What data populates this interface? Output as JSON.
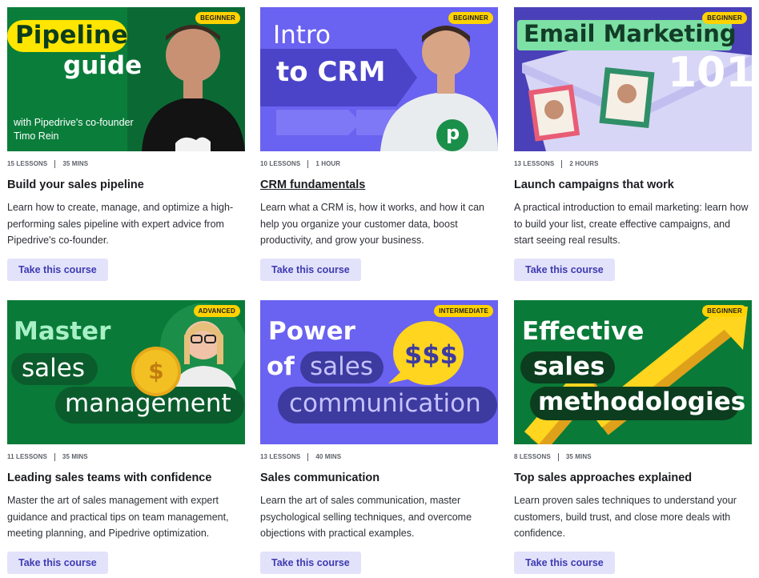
{
  "cards": [
    {
      "badge": "BEGINNER",
      "lessons": "15 LESSONS",
      "duration": "35 MINS",
      "title": "Build your sales pipeline",
      "description": "Learn how to create, manage, and optimize a high-performing sales pipeline with expert advice from Pipedrive's co-founder.",
      "button": "Take this course",
      "art": {
        "line1": "Pipeline",
        "line2": "guide",
        "caption1": "with Pipedrive's co-founder",
        "caption2": "Timo Rein"
      }
    },
    {
      "badge": "BEGINNER",
      "lessons": "10 LESSONS",
      "duration": "1 HOUR",
      "title": "CRM fundamentals",
      "description": "Learn what a CRM is, how it works, and how it can help you organize your customer data, boost productivity, and grow your business.",
      "button": "Take this course",
      "art": {
        "line1": "Intro",
        "line2": "to CRM",
        "logo": "p"
      }
    },
    {
      "badge": "BEGINNER",
      "lessons": "13 LESSONS",
      "duration": "2 HOURS",
      "title": "Launch campaigns that work",
      "description": "A practical introduction to email marketing: learn how to build your list, create effective campaigns, and start seeing real results.",
      "button": "Take this course",
      "art": {
        "line1": "Email Marketing",
        "line2": "101"
      }
    },
    {
      "badge": "ADVANCED",
      "lessons": "11 LESSONS",
      "duration": "35 MINS",
      "title": "Leading sales teams with confidence",
      "description": "Master the art of sales management with expert guidance and practical tips on team management, meeting planning, and Pipedrive optimization.",
      "button": "Take this course",
      "art": {
        "line1": "Master",
        "line2": "sales",
        "line3": "management",
        "coin": "$"
      }
    },
    {
      "badge": "INTERMEDIATE",
      "lessons": "13 LESSONS",
      "duration": "40 MINS",
      "title": "Sales communication",
      "description": "Learn the art of sales communication, master psychological selling techniques, and overcome objections with practical examples.",
      "button": "Take this course",
      "art": {
        "line1": "Power",
        "line2a": "of",
        "line2b": "sales",
        "line3": "communication",
        "bubble": "$$$"
      }
    },
    {
      "badge": "BEGINNER",
      "lessons": "8 LESSONS",
      "duration": "35 MINS",
      "title": "Top sales approaches explained",
      "description": "Learn proven sales techniques to understand your customers, build trust, and close more deals with confidence.",
      "button": "Take this course",
      "art": {
        "line1": "Effective",
        "line2": "sales",
        "line3": "methodologies"
      }
    }
  ]
}
